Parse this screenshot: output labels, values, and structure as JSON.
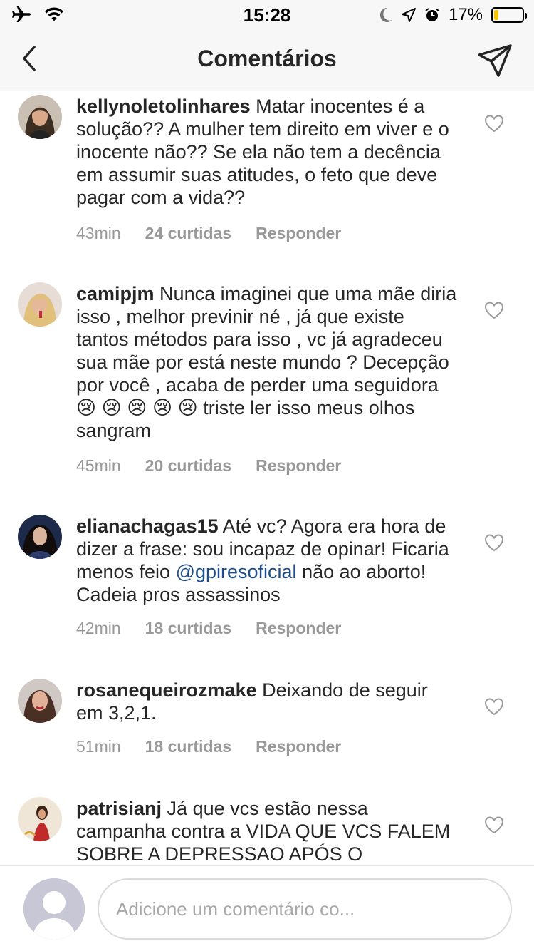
{
  "status_bar": {
    "time": "15:28",
    "battery_label": "17%",
    "battery_level": 0.17,
    "icons": [
      "airplane-icon",
      "wifi-icon",
      "moon-icon",
      "location-icon",
      "alarm-icon",
      "battery-icon"
    ]
  },
  "nav": {
    "title": "Comentários",
    "back_icon": "chevron-left-icon",
    "send_icon": "send-icon"
  },
  "comments": [
    {
      "username": "kellynoletolinhares",
      "text": " Matar inocentes é a solução?? A mulher tem direito em viver e o inocente não?? Se ela não tem a decência em assumir suas atitudes, o feto que deve pagar com a vida??",
      "time": "43min",
      "likes": "24 curtidas",
      "reply": "Responder"
    },
    {
      "username": "camipjm",
      "text": " Nunca imaginei que uma mãe diria isso , melhor previnir né , já que existe tantos métodos para isso , vc já agradeceu sua mãe por está neste mundo ? Decepção por você , acaba de perder uma seguidora 😢 😢 😢 😢 😢 triste ler isso meus olhos sangram",
      "time": "45min",
      "likes": "20 curtidas",
      "reply": "Responder"
    },
    {
      "username": "elianachagas15",
      "text_before": " Até vc? Agora era hora de dizer a frase: sou incapaz de opinar! Ficaria menos feio ",
      "mention": "@gpiresoficial",
      "text_after": "  não ao aborto! Cadeia pros assassinos",
      "time": "42min",
      "likes": "18 curtidas",
      "reply": "Responder"
    },
    {
      "username": "rosanequeirozmake",
      "text": " Deixando de seguir em 3,2,1.",
      "time": "51min",
      "likes": "18 curtidas",
      "reply": "Responder"
    },
    {
      "username": "patrisianj",
      "text": " Já que vcs estão nessa campanha contra a VIDA QUE VCS FALEM SOBRE A DEPRESSAO APÓS O"
    }
  ],
  "composer": {
    "placeholder": "Adicione um comentário co..."
  },
  "colors": {
    "bar_bg": "#f7f7f7",
    "meta_text": "#999999",
    "mention": "#1f4e8c",
    "battery": "#f5c400"
  }
}
